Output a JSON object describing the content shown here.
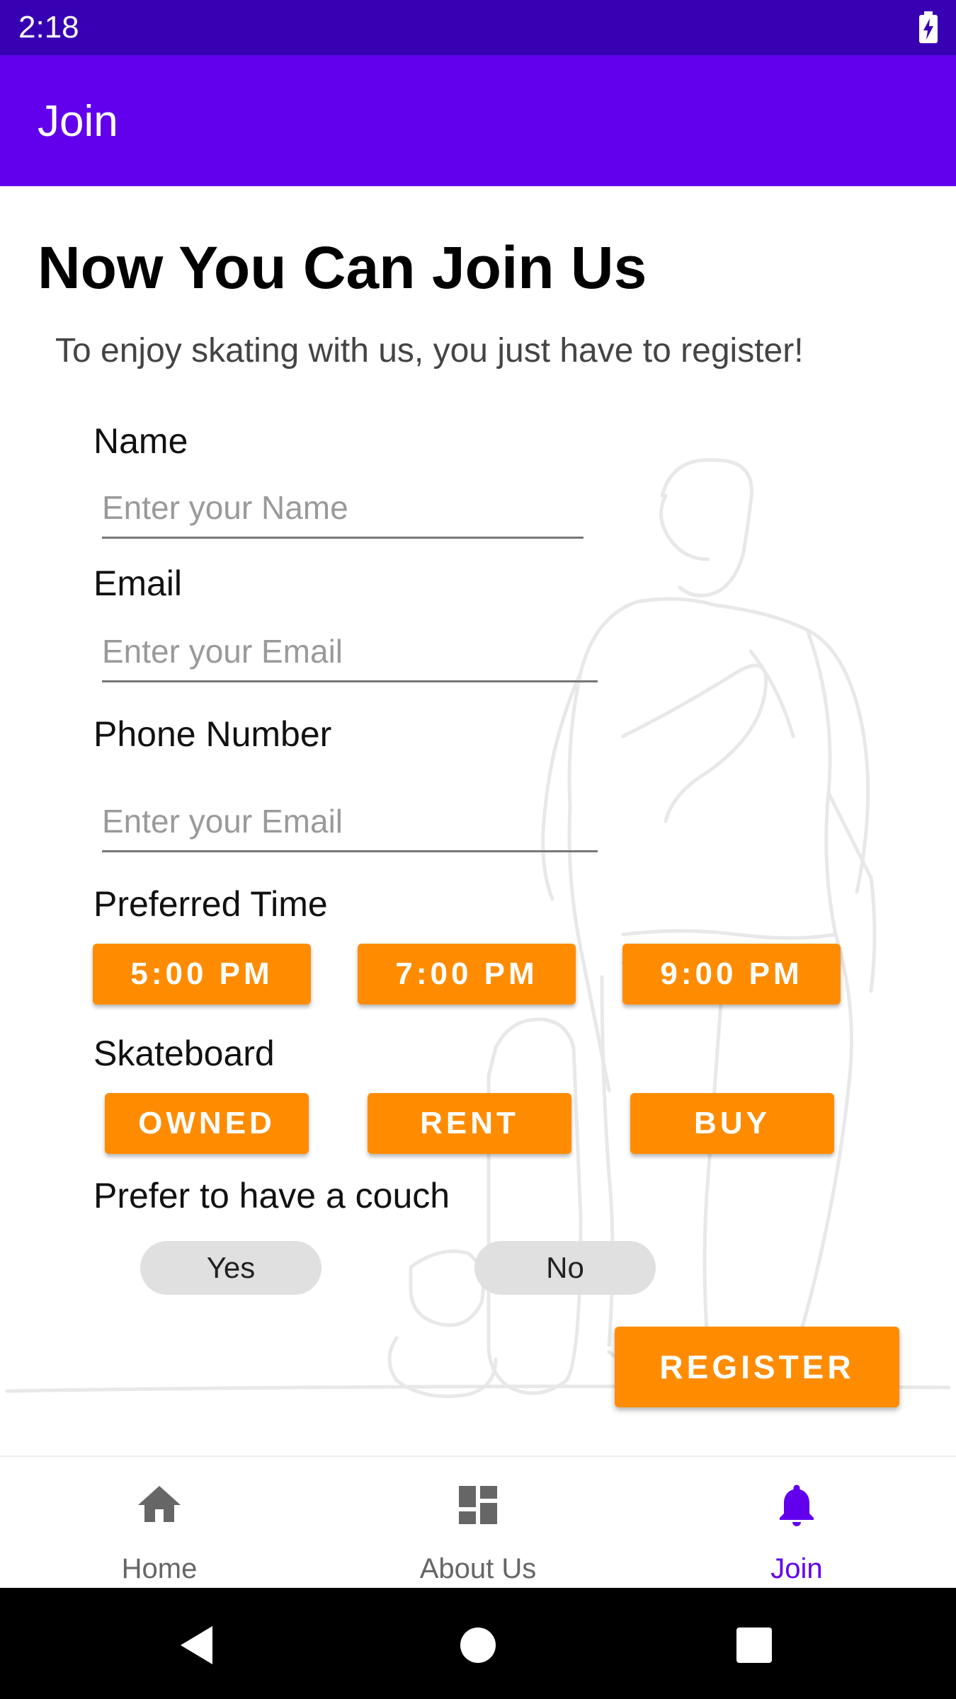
{
  "status_bar": {
    "time": "2:18",
    "battery_icon": "battery-charging-icon"
  },
  "app_bar": {
    "title": "Join"
  },
  "main": {
    "heading": "Now You Can Join Us",
    "subheading": "To enjoy skating with us, you just have to register!",
    "name": {
      "label": "Name",
      "placeholder": "Enter your Name",
      "value": ""
    },
    "email": {
      "label": "Email",
      "placeholder": "Enter your Email",
      "value": ""
    },
    "phone": {
      "label": "Phone Number",
      "placeholder": "Enter your Email",
      "value": ""
    },
    "preferred_time": {
      "label": "Preferred Time",
      "options": [
        "5:00 PM",
        "7:00 PM",
        "9:00 PM"
      ]
    },
    "skateboard": {
      "label": "Skateboard",
      "options": [
        "OWNED",
        "RENT",
        "BUY"
      ]
    },
    "couch": {
      "label": "Prefer to have a couch",
      "options": [
        "Yes",
        "No"
      ]
    },
    "register_label": "REGISTER"
  },
  "bottom_nav": {
    "items": [
      {
        "label": "Home",
        "icon": "home-icon",
        "active": false
      },
      {
        "label": "About Us",
        "icon": "dashboard-icon",
        "active": false
      },
      {
        "label": "Join",
        "icon": "bell-icon",
        "active": true
      }
    ]
  },
  "colors": {
    "status_bar": "#3700b3",
    "app_bar": "#6200ee",
    "accent_orange": "#ff8c00",
    "nav_active": "#6200ee",
    "nav_inactive": "#666666"
  }
}
